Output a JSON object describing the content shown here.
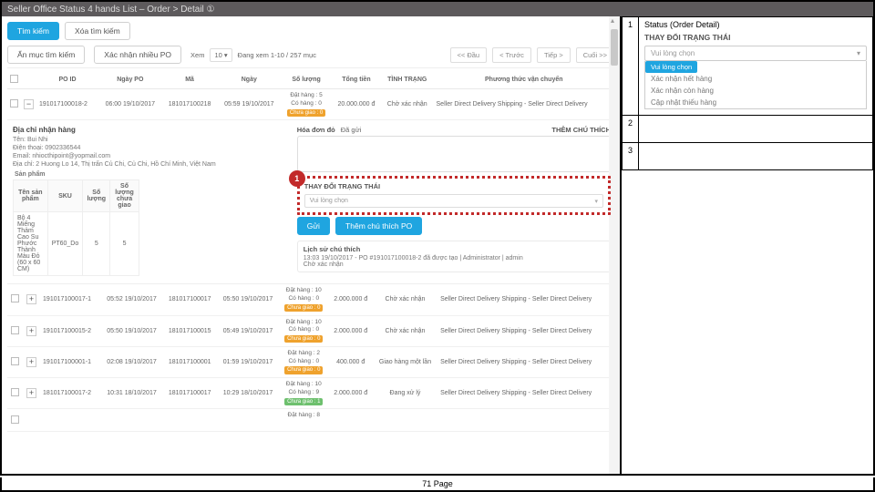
{
  "topbar": "Seller Office Status 4 hands List – Order > Detail ①",
  "toolbar": {
    "search": "Tìm kiếm",
    "clear": "Xóa tìm kiếm",
    "hideSearch": "Ẩn mục tìm kiếm",
    "confirmMulti": "Xác nhận nhiều PO",
    "view": "Xem",
    "viewCount": "10",
    "range": "Đang xem 1-10 / 257 mục",
    "first": "<< Đầu",
    "prev": "< Trước",
    "next": "Tiếp >",
    "last": "Cuối >>"
  },
  "columns": [
    "",
    "",
    "PO ID",
    "Ngày PO",
    "Mã",
    "Ngày",
    "Số lượng",
    "Tổng tiền",
    "TÌNH TRẠNG",
    "Phương thức vận chuyển"
  ],
  "rows": [
    {
      "pm": "−",
      "po": "191017100018-2",
      "ngaypo": "06:00 19/10/2017",
      "ma": "181017100218",
      "ngay": "05:59 19/10/2017",
      "qty": {
        "dat": "Đặt hàng : 5",
        "co": "Có hàng : 0",
        "chip": "Chưa giao : 0",
        "chipClass": "tag-y"
      },
      "tien": "20.000.000 đ",
      "tt": "Chờ xác nhận",
      "vc": "Seller Direct Delivery Shipping - Seller Direct Delivery"
    }
  ],
  "detail": {
    "addrTitle": "Địa chỉ nhận hàng",
    "ten": "Tên: Bui Nhi",
    "dt": "Điện thoại: 0902336544",
    "email": "Email: nhiocthipoint@yopmail.com",
    "dc": "Địa chỉ: 2 Huong Lo 14, Thị trấn Củ Chi, Củ Chi, Hồ Chí Minh, Việt Nam",
    "hoadon": "Hóa đơn đỏ",
    "dagui": "Đã gửi",
    "them": "THÊM CHÚ THÍCH",
    "statusHd": "THAY ĐỔI TRẠNG THÁI",
    "statusPh": "Vui lòng chọn",
    "send": "Gửi",
    "addNote": "Thêm chú thích PO",
    "mark": "1",
    "spTitle": "Sản phẩm",
    "prodCols": [
      "Tên sản phẩm",
      "SKU",
      "Số lượng",
      "Số lượng chưa giao"
    ],
    "prod": {
      "name": "Bộ 4 Miếng Thảm Cao Su Phước Thành Màu Đỏ (60 x 60 CM)",
      "sku": "PT60_Do",
      "q": "5",
      "q2": "5"
    },
    "histT": "Lịch sử chú thích",
    "histLine": "13:03 19/10/2017 - PO #191017100018-2 đã được tạo | Administrator | admin",
    "histLine2": "Chờ xác nhận"
  },
  "rows2": [
    {
      "pm": "+",
      "po": "191017100017-1",
      "ngaypo": "05:52 19/10/2017",
      "ma": "181017100017",
      "ngay": "05:50 19/10/2017",
      "qty": {
        "dat": "Đặt hàng : 10",
        "co": "Có hàng : 0",
        "chip": "Chưa giao : 0",
        "chipClass": "tag-y"
      },
      "tien": "2.000.000 đ",
      "tt": "Chờ xác nhận",
      "vc": "Seller Direct Delivery Shipping - Seller Direct Delivery"
    },
    {
      "pm": "+",
      "po": "191017100015-2",
      "ngaypo": "05:50 19/10/2017",
      "ma": "181017100015",
      "ngay": "05:49 19/10/2017",
      "qty": {
        "dat": "Đặt hàng : 10",
        "co": "Có hàng : 0",
        "chip": "Chưa giao : 0",
        "chipClass": "tag-y"
      },
      "tien": "2.000.000 đ",
      "tt": "Chờ xác nhận",
      "vc": "Seller Direct Delivery Shipping - Seller Direct Delivery"
    },
    {
      "pm": "+",
      "po": "191017100001-1",
      "ngaypo": "02:08 19/10/2017",
      "ma": "181017100001",
      "ngay": "01:59 19/10/2017",
      "qty": {
        "dat": "Đặt hàng : 2",
        "co": "Có hàng : 0",
        "chip": "Chưa giao : 0",
        "chipClass": "tag-y"
      },
      "tien": "400.000 đ",
      "tt": "Giao hàng một lần",
      "vc": "Seller Direct Delivery Shipping - Seller Direct Delivery"
    },
    {
      "pm": "+",
      "po": "181017100017-2",
      "ngaypo": "10:31 18/10/2017",
      "ma": "181017100017",
      "ngay": "10:29 18/10/2017",
      "qty": {
        "dat": "Đặt hàng : 10",
        "co": "Có hàng : 9",
        "chip": "Chưa giao : 1",
        "chipClass": "tag-g"
      },
      "tien": "2.000.000 đ",
      "tt": "Đang xử lý",
      "vc": "Seller Direct Delivery Shipping - Seller Direct Delivery"
    },
    {
      "pm": "",
      "po": "",
      "ngaypo": "",
      "ma": "",
      "ngay": "",
      "qty": {
        "dat": "Đặt hàng : 8",
        "co": "",
        "chip": "",
        "chipClass": ""
      },
      "tien": "",
      "tt": "",
      "vc": ""
    }
  ],
  "rightPanel": {
    "r1label": "Status (Order Detail)",
    "title": "THAY ĐỔI TRẠNG THÁI",
    "ph": "Vui lòng chọn",
    "opts": [
      "Vui lòng chọn",
      "Xác nhận hết hàng",
      "Xác nhận còn hàng",
      "Cập nhật thiếu hàng"
    ]
  },
  "footer": "71 Page"
}
